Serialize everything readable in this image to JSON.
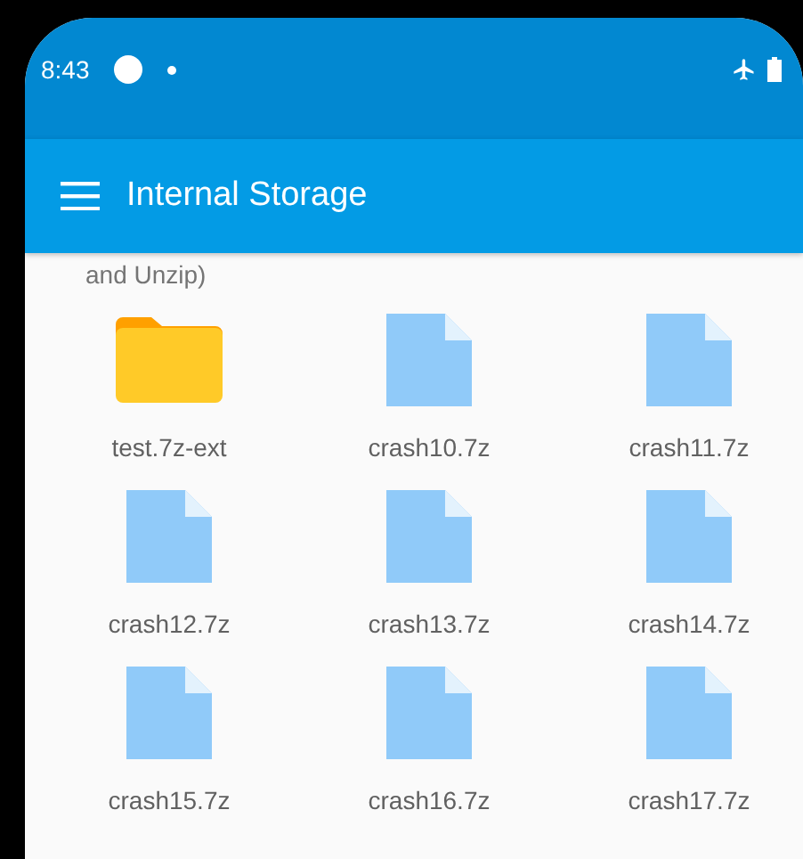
{
  "status_bar": {
    "time": "8:43"
  },
  "app_bar": {
    "title": "Internal Storage"
  },
  "note": "and Unzip)",
  "files": [
    {
      "name": "test.7z-ext",
      "kind": "folder"
    },
    {
      "name": "crash10.7z",
      "kind": "file"
    },
    {
      "name": "crash11.7z",
      "kind": "file"
    },
    {
      "name": "crash12.7z",
      "kind": "file"
    },
    {
      "name": "crash13.7z",
      "kind": "file"
    },
    {
      "name": "crash14.7z",
      "kind": "file"
    },
    {
      "name": "crash15.7z",
      "kind": "file"
    },
    {
      "name": "crash16.7z",
      "kind": "file"
    },
    {
      "name": "crash17.7z",
      "kind": "file"
    }
  ]
}
